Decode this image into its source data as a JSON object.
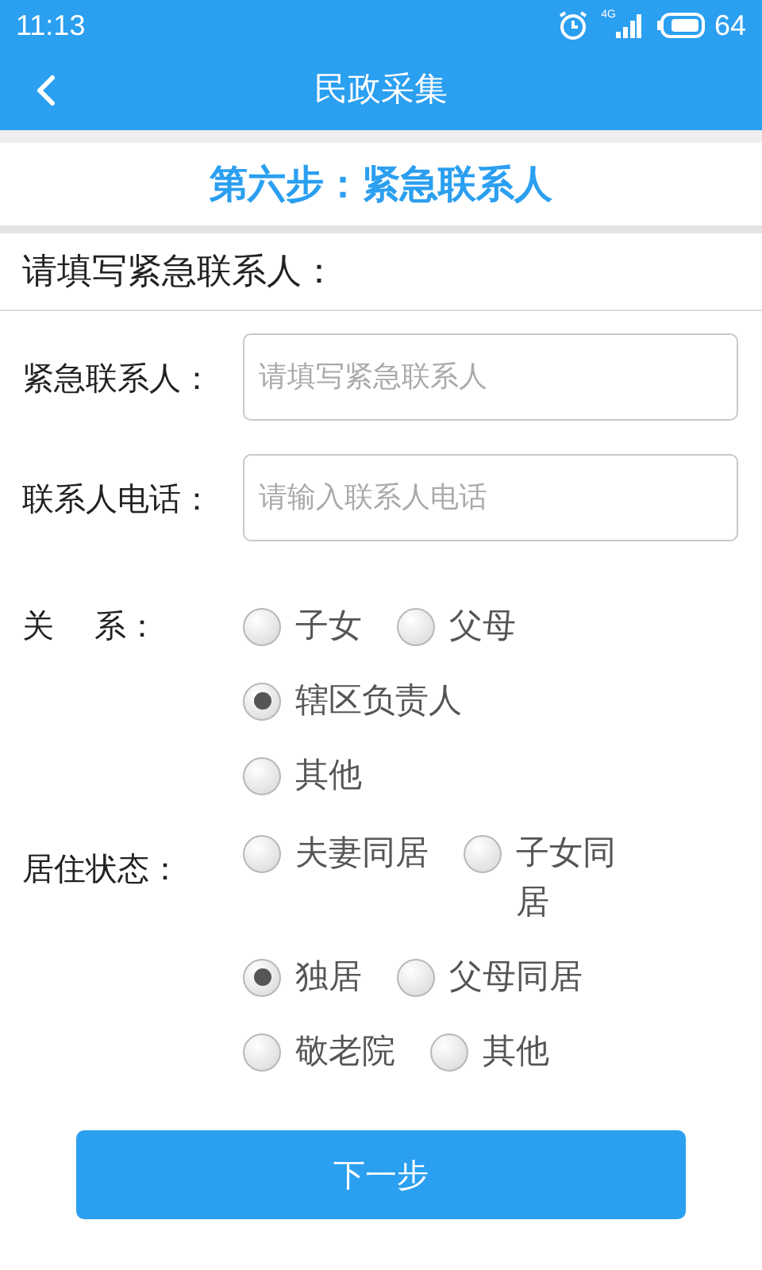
{
  "status_bar": {
    "time": "11:13",
    "network": "4G",
    "battery": "64"
  },
  "header": {
    "title": "民政采集"
  },
  "step_title": "第六步：紧急联系人",
  "section_title": "请填写紧急联系人：",
  "fields": [
    {
      "label": "紧急联系人：",
      "placeholder": "请填写紧急联系人"
    },
    {
      "label": "联系人电话：",
      "placeholder": "请输入联系人电话"
    }
  ],
  "radio_groups": [
    {
      "label": "关    系：",
      "rows": [
        [
          {
            "label": "子女",
            "selected": false
          },
          {
            "label": "父母",
            "selected": false
          }
        ],
        [
          {
            "label": "辖区负责人",
            "selected": true
          }
        ],
        [
          {
            "label": "其他",
            "selected": false
          }
        ]
      ]
    },
    {
      "label": "居住状态：",
      "rows": [
        [
          {
            "label": "夫妻同居",
            "selected": false
          },
          {
            "label": "子女同居",
            "selected": false
          }
        ],
        [
          {
            "label": "独居",
            "selected": true
          },
          {
            "label": "父母同居",
            "selected": false
          }
        ],
        [
          {
            "label": "敬老院",
            "selected": false
          },
          {
            "label": "其他",
            "selected": false
          }
        ]
      ]
    }
  ],
  "next_button": "下一步"
}
